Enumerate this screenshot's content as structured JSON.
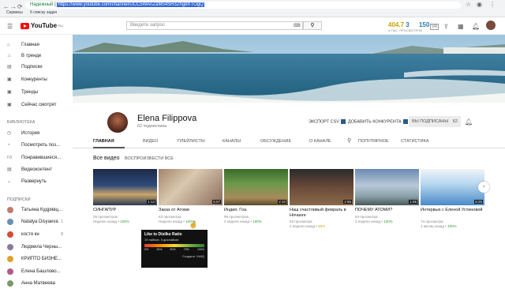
{
  "browser": {
    "url_prefix": "Надежный",
    "url": "https://www.youtube.com/channel/UCC5WAnZaM54SH3Zhg8XTOgQ",
    "bookmarks": [
      "Сервисы",
      "6 списку задач"
    ]
  },
  "header": {
    "logo": "YouTube",
    "logo_region": "RU",
    "search_placeholder": "Введите запрос",
    "stat1": "404.7",
    "stat2": "3",
    "stat3": "150",
    "stat_label": "6 TЫС. ПРОСМОТРОВ",
    "vr": "VR"
  },
  "sidebar": {
    "main": [
      {
        "label": "Главная",
        "icon": "home-icon"
      },
      {
        "label": "В тренде",
        "icon": "trending-icon"
      },
      {
        "label": "Подписки",
        "icon": "subscriptions-icon"
      },
      {
        "label": "Конкуренты",
        "icon": "competitors-icon"
      },
      {
        "label": "Тренды",
        "icon": "trends-icon"
      },
      {
        "label": "Сейчас смотрят",
        "icon": "watching-icon"
      }
    ],
    "library_title": "БИБЛИОТЕКА",
    "library": [
      {
        "label": "История",
        "icon": "history-icon"
      },
      {
        "label": "Посмотреть поз...",
        "icon": "watch-later-icon"
      },
      {
        "label": "Понравившиеся...",
        "icon": "liked-icon"
      },
      {
        "label": "Видеоконтент",
        "icon": "video-content-icon"
      },
      {
        "label": "Развернуть",
        "icon": "expand-icon"
      }
    ],
    "subs_title": "ПОДПИСКИ",
    "subs": [
      {
        "label": "Татьяна Кудрявц...",
        "count": "",
        "color": "#c47a6e"
      },
      {
        "label": "Natalya Disyaeva",
        "count": "1",
        "color": "#6b8fb5"
      },
      {
        "label": "костя кн",
        "count": "8",
        "color": "#d94a3a"
      },
      {
        "label": "Людмила Черны...",
        "count": "",
        "color": "#8a7a9a"
      },
      {
        "label": "КРИПТО БИЗНЕ...",
        "count": "",
        "color": "#e0a030"
      },
      {
        "label": "Елена Башлово...",
        "count": "",
        "color": "#b05a8a"
      },
      {
        "label": "Анна Матвеева",
        "count": "",
        "color": "#7a9a6a"
      }
    ]
  },
  "channel": {
    "name": "Elena Filippova",
    "subscribers": "62 подписчика",
    "export": "ЭКСПОРТ CSV",
    "add_competitor": "ДОБАВИТЬ КОНКУРЕНТА",
    "subscribed": "ВЫ ПОДПИСАНЫ",
    "sub_count": "62"
  },
  "tabs": [
    "ГЛАВНАЯ",
    "ВИДЕО",
    "ПЛЕЙЛИСТЫ",
    "КАНАЛЫ",
    "ОБСУЖДЕНИЕ",
    "О КАНАЛЕ",
    "ПОПУЛЯРНОЕ",
    "СТАТИСТИКА"
  ],
  "section": {
    "title": "Все видео",
    "play_all": "ВОСПРОИЗВЕСТИ ВСЕ"
  },
  "videos": [
    {
      "title": "СИНГАПУР",
      "duration": "1:12",
      "views": "26 просмотров",
      "age": "Неделю назад",
      "rating": "100%"
    },
    {
      "title": "Заказ от Атоми",
      "duration": "6:07",
      "views": "63 просмотра",
      "age": "Неделю назад",
      "rating": "100%"
    },
    {
      "title": "Индия. Гоа.",
      "duration": "2:10",
      "views": "99 просмотров",
      "age": "2 недели назад",
      "rating": "100%"
    },
    {
      "title": "Наш счастливый февраль в Нячанге",
      "duration": "2:55",
      "views": "53 просмотра",
      "age": "2 недели назад",
      "rating": "83%"
    },
    {
      "title": "ПОЧЕМУ АТОМИ?",
      "duration": "1:06",
      "views": "54 просмотра",
      "age": "3 недели назад",
      "rating": "100%"
    },
    {
      "title": "Интервью с Еленой Устиновой",
      "duration": "8:25",
      "views": "74 просмотра",
      "age": "1 месяц назад",
      "rating": "100%"
    }
  ],
  "tooltip": {
    "title": "Like to Dislike Ratio",
    "subtitle": "19 лайков, 0 дизлайков",
    "ticks": [
      "0%",
      "25%",
      "50%",
      "75%",
      "100%"
    ],
    "footer": "Создано: VidIQ"
  }
}
